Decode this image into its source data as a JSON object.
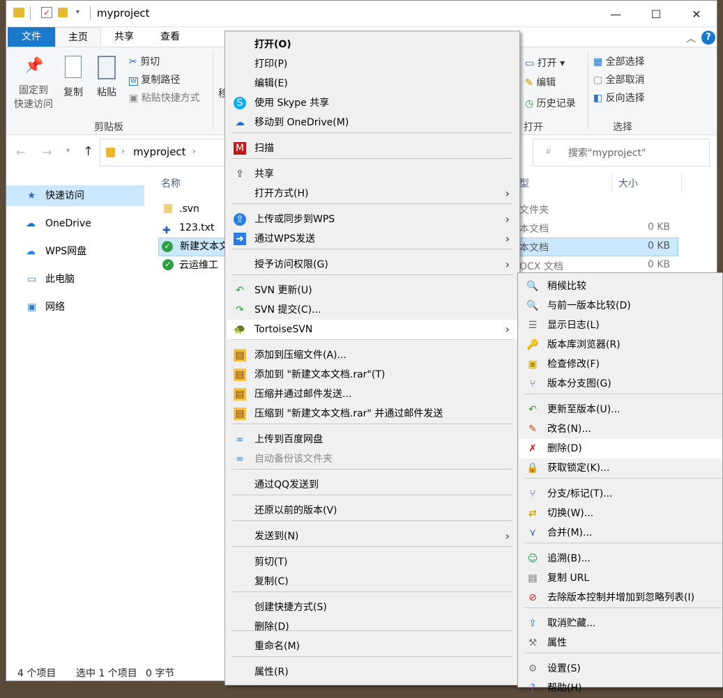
{
  "window": {
    "title": "myproject",
    "controls": {
      "minimize": "—",
      "maximize": "☐",
      "close": "✕"
    },
    "help": "?"
  },
  "ribbon": {
    "tabs": [
      "文件",
      "主页",
      "共享",
      "查看"
    ],
    "clipboard": {
      "pin": "固定到\n快速访问",
      "pin_l1": "固定到",
      "pin_l2": "快速访问",
      "copy": "复制",
      "paste": "粘贴",
      "cut": "剪切",
      "copy_path": "复制路径",
      "paste_shortcut": "粘贴快捷方式",
      "group": "剪贴板",
      "clipped": "移"
    },
    "open": {
      "open": "打开 ▾",
      "edit": "编辑",
      "history": "历史记录",
      "group": "打开"
    },
    "select": {
      "all": "全部选择",
      "none": "全部取消",
      "invert": "反向选择",
      "group": "选择"
    }
  },
  "address": {
    "path": "myproject",
    "search_placeholder": "搜索\"myproject\""
  },
  "nav": {
    "items": [
      "快速访问",
      "OneDrive",
      "WPS网盘",
      "此电脑",
      "网络"
    ]
  },
  "columns": {
    "name": "名称",
    "type": "类型",
    "type_visible": "型",
    "size": "大小"
  },
  "files": [
    {
      "name": ".svn",
      "type": "文件夹",
      "type_visible": "文件夹",
      "size": ""
    },
    {
      "name": "123.txt",
      "type": "文本文档",
      "type_visible": "本文档",
      "size": "0 KB"
    },
    {
      "name": "新建文本文",
      "type": "文本文档",
      "type_visible": "本文档",
      "size": "0 KB"
    },
    {
      "name": "云运维工",
      "type": "DOCX 文档",
      "type_visible": "OCX 文档",
      "size": "0 KB"
    }
  ],
  "status": {
    "count": "4 个项目",
    "selected": "选中 1 个项目",
    "bytes": "0 字节"
  },
  "context_menu": [
    {
      "label": "打开(O)",
      "icon": "",
      "bold": true
    },
    {
      "label": "打印(P)",
      "icon": ""
    },
    {
      "label": "编辑(E)",
      "icon": ""
    },
    {
      "label": "使用 Skype 共享",
      "icon": "skype-icon"
    },
    {
      "label": "移动到 OneDrive(M)",
      "icon": "onedrive-icon"
    },
    {
      "label": "扫描",
      "icon": "mcafee-icon"
    },
    {
      "label": "共享",
      "icon": "share-icon"
    },
    {
      "label": "打开方式(H)",
      "icon": "",
      "submenu": true
    },
    {
      "label": "上传或同步到WPS",
      "icon": "wps-upload-icon",
      "submenu": true
    },
    {
      "label": "通过WPS发送",
      "icon": "wps-send-icon",
      "submenu": true
    },
    {
      "label": "授予访问权限(G)",
      "icon": "",
      "submenu": true
    },
    {
      "label": "SVN 更新(U)",
      "icon": "svn-update-icon"
    },
    {
      "label": "SVN 提交(C)...",
      "icon": "svn-commit-icon"
    },
    {
      "label": "TortoiseSVN",
      "icon": "tortoisesvn-icon",
      "submenu": true,
      "highlight": true
    },
    {
      "label": "添加到压缩文件(A)...",
      "icon": "winrar-icon"
    },
    {
      "label": "添加到 \"新建文本文档.rar\"(T)",
      "icon": "winrar-icon"
    },
    {
      "label": "压缩并通过邮件发送...",
      "icon": "winrar-icon"
    },
    {
      "label": "压缩到 \"新建文本文档.rar\" 并通过邮件发送",
      "icon": "winrar-icon"
    },
    {
      "label": "上传到百度网盘",
      "icon": "baidu-icon"
    },
    {
      "label": "自动备份该文件夹",
      "icon": "baidu-icon",
      "disabled": true
    },
    {
      "label": "通过QQ发送到",
      "icon": ""
    },
    {
      "label": "还原以前的版本(V)",
      "icon": ""
    },
    {
      "label": "发送到(N)",
      "icon": "",
      "submenu": true
    },
    {
      "label": "剪切(T)",
      "icon": ""
    },
    {
      "label": "复制(C)",
      "icon": ""
    },
    {
      "label": "创建快捷方式(S)",
      "icon": ""
    },
    {
      "label": "删除(D)",
      "icon": ""
    },
    {
      "label": "重命名(M)",
      "icon": ""
    },
    {
      "label": "属性(R)",
      "icon": ""
    }
  ],
  "svn_menu": [
    {
      "label": "稍候比较",
      "icon": "diff-later-icon"
    },
    {
      "label": "与前一版本比较(D)",
      "icon": "diff-previous-icon"
    },
    {
      "label": "显示日志(L)",
      "icon": "log-icon"
    },
    {
      "label": "版本库浏览器(R)",
      "icon": "repo-browser-icon"
    },
    {
      "label": "检查修改(F)",
      "icon": "check-modifications-icon"
    },
    {
      "label": "版本分支图(G)",
      "icon": "revision-graph-icon"
    },
    {
      "label": "更新至版本(U)...",
      "icon": "update-to-revision-icon"
    },
    {
      "label": "改名(N)...",
      "icon": "rename-icon"
    },
    {
      "label": "删除(D)",
      "icon": "delete-icon",
      "highlight": true
    },
    {
      "label": "获取锁定(K)...",
      "icon": "lock-icon"
    },
    {
      "label": "分支/标记(T)...",
      "icon": "branch-icon"
    },
    {
      "label": "切换(W)...",
      "icon": "switch-icon"
    },
    {
      "label": "合并(M)...",
      "icon": "merge-icon"
    },
    {
      "label": "追溯(B)...",
      "icon": "blame-icon"
    },
    {
      "label": "复制 URL",
      "icon": "copy-url-icon"
    },
    {
      "label": "去除版本控制并增加到忽略列表(I)",
      "icon": "ignore-icon"
    },
    {
      "label": "取消贮藏...",
      "icon": "unshelve-icon"
    },
    {
      "label": "属性",
      "icon": "properties-icon"
    },
    {
      "label": "设置(S)",
      "icon": "settings-icon"
    },
    {
      "label": "帮助(H)",
      "icon": "help-icon"
    }
  ]
}
